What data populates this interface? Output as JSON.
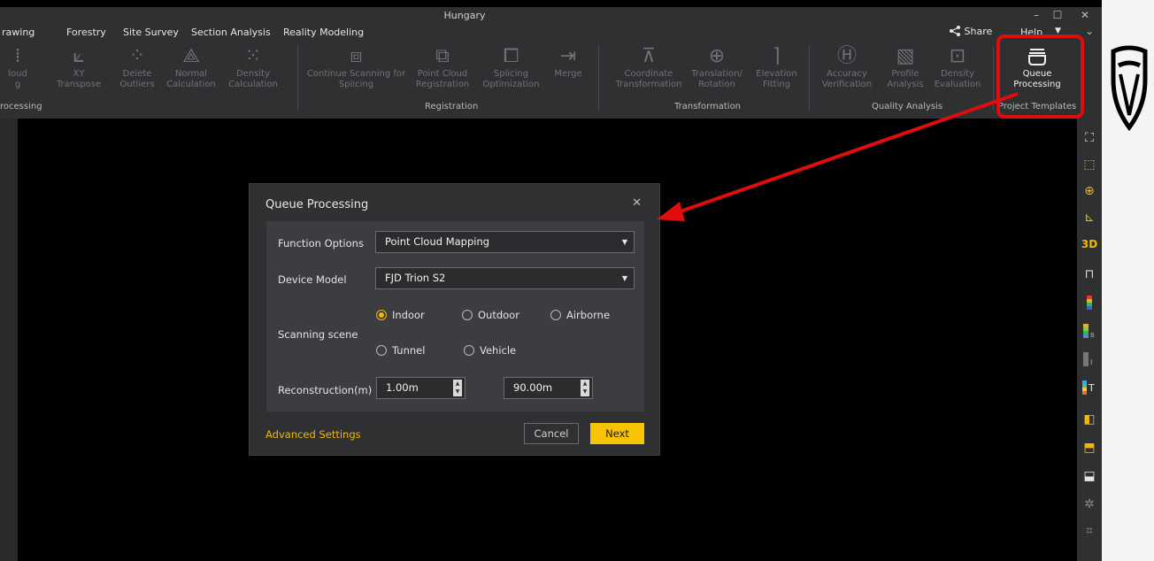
{
  "window": {
    "title": "Hungary",
    "minimize_icon": "minimize-icon",
    "maximize_icon": "maximize-icon",
    "close_icon": "close-icon"
  },
  "menu": {
    "items": [
      "rawing",
      "Forestry",
      "Site Survey",
      "Section Analysis",
      "Reality Modeling"
    ],
    "share": "Share",
    "help": "Help"
  },
  "ribbon": {
    "buttons": [
      {
        "label": "loud\ng",
        "icon": "point-cloud-icon"
      },
      {
        "label": "XY Transpose",
        "icon": "transpose-icon"
      },
      {
        "label": "Delete\nOutliers",
        "icon": "delete-outliers-icon"
      },
      {
        "label": "Normal\nCalculation",
        "icon": "normal-calc-icon"
      },
      {
        "label": "Density\nCalculation",
        "icon": "density-icon"
      },
      {
        "label": "Continue Scanning for\nSplicing",
        "icon": "continue-scan-icon"
      },
      {
        "label": "Point Cloud\nRegistration",
        "icon": "puzzle-icon"
      },
      {
        "label": "Splicing\nOptimization",
        "icon": "splice-opt-icon"
      },
      {
        "label": "Merge",
        "icon": "merge-icon"
      },
      {
        "label": "Coordinate\nTransformation",
        "icon": "coordinate-icon"
      },
      {
        "label": "Translation/\nRotation",
        "icon": "move-icon"
      },
      {
        "label": "Elevation\nFitting",
        "icon": "elevation-icon"
      },
      {
        "label": "Accuracy\nVerification",
        "icon": "accuracy-icon"
      },
      {
        "label": "Profile\nAnalysis",
        "icon": "profile-icon"
      },
      {
        "label": "Density\nEvaluation",
        "icon": "density-eval-icon"
      },
      {
        "label": "Queue\nProcessing",
        "icon": "queue-icon"
      }
    ],
    "groups": {
      "processing": "rocessing",
      "registration": "Registration",
      "transformation": "Transformation",
      "quality": "Quality Analysis",
      "templates": "Project Templates"
    }
  },
  "dialog": {
    "title": "Queue Processing",
    "function_label": "Function Options",
    "function_value": "Point Cloud Mapping",
    "device_label": "Device Model",
    "device_value": "FJD Trion S2",
    "scene_label": "Scanning scene",
    "scenes": [
      {
        "label": "Indoor",
        "checked": true
      },
      {
        "label": "Outdoor",
        "checked": false
      },
      {
        "label": "Airborne",
        "checked": false
      },
      {
        "label": "Tunnel",
        "checked": false
      },
      {
        "label": "Vehicle",
        "checked": false
      }
    ],
    "recon_label": "Reconstruction(m)",
    "recon_min": "1.00m",
    "recon_max": "90.00m",
    "advanced": "Advanced Settings",
    "cancel": "Cancel",
    "next": "Next"
  },
  "right_toolbar": [
    "fit-view-icon",
    "box-icon",
    "orbit-icon",
    "axis-icon",
    "3D",
    "lock-icon",
    "color-bar-icon",
    "color-bar-b-icon",
    "intensity-icon",
    "T",
    "cube-front-icon",
    "cube-top-icon",
    "cube-side-icon",
    "measure-icon",
    "crop-icon"
  ],
  "colors": {
    "accent": "#f2b705",
    "highlight": "#e10d0d",
    "background": "#000000",
    "panel": "#2f3032"
  }
}
